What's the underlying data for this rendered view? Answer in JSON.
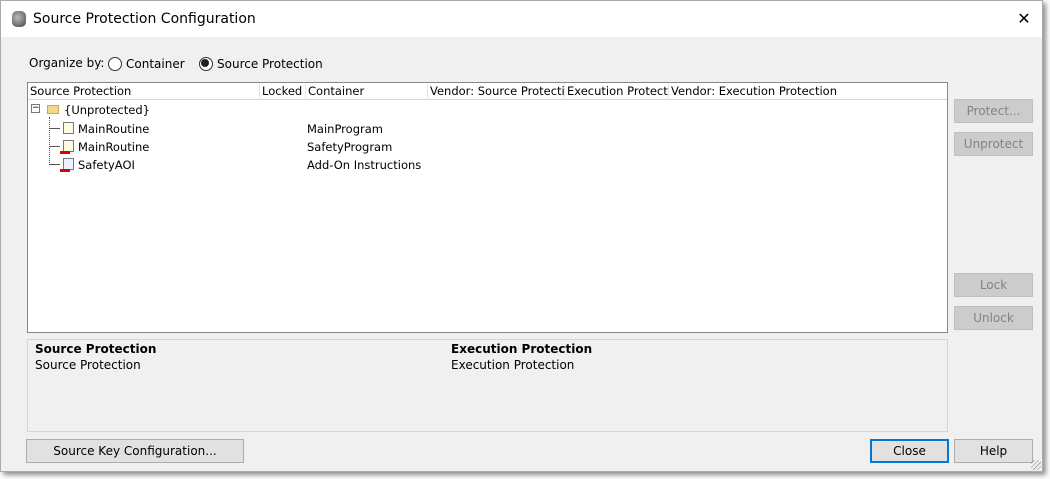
{
  "window": {
    "title": "Source Protection Configuration"
  },
  "organize": {
    "label": "Organize by:",
    "options": [
      {
        "label": "Container",
        "selected": false
      },
      {
        "label": "Source Protection",
        "selected": true
      }
    ]
  },
  "table": {
    "columns": [
      "Source Protection",
      "Locked",
      "Container",
      "Vendor: Source Protection",
      "Execution Protection",
      "Vendor: Execution Protection"
    ],
    "group": "{Unprotected}",
    "rows": [
      {
        "name": "MainRoutine",
        "container": "MainProgram",
        "icon": "routine-icon"
      },
      {
        "name": "MainRoutine",
        "container": "SafetyProgram",
        "icon": "safety-routine-icon"
      },
      {
        "name": "SafetyAOI",
        "container": "Add-On Instructions",
        "icon": "safety-aoi-icon"
      }
    ]
  },
  "details": {
    "source_heading": "Source Protection",
    "source_value": "Source Protection",
    "exec_heading": "Execution Protection",
    "exec_value": "Execution Protection"
  },
  "buttons": {
    "protect": "Protect...",
    "unprotect": "Unprotect",
    "lock": "Lock",
    "unlock": "Unlock",
    "source_key": "Source Key Configuration...",
    "close": "Close",
    "help": "Help"
  },
  "colors": {
    "accent": "#0078d7",
    "safety": "#dd0000"
  }
}
